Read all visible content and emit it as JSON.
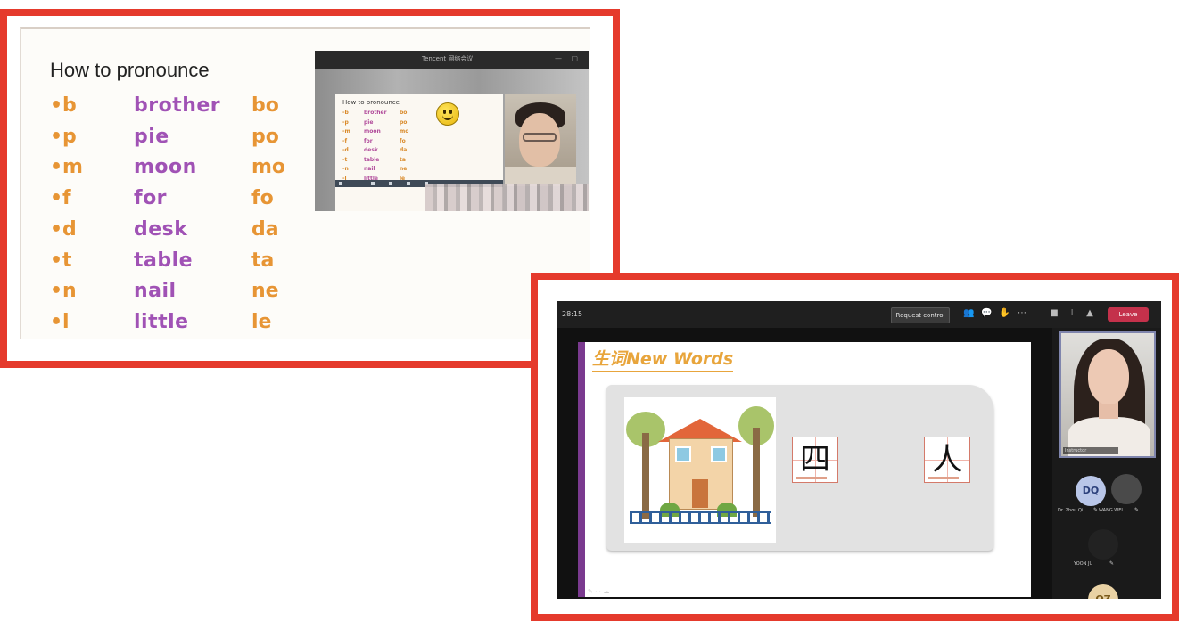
{
  "shot1": {
    "slide_title": "How to pronounce",
    "rows": [
      {
        "bullet": "•b",
        "word": "brother",
        "syllable": "bo"
      },
      {
        "bullet": "•p",
        "word": "pie",
        "syllable": "po"
      },
      {
        "bullet": "•m",
        "word": "moon",
        "syllable": "mo"
      },
      {
        "bullet": "•f",
        "word": "for",
        "syllable": "fo"
      },
      {
        "bullet": "•d",
        "word": "desk",
        "syllable": "da"
      },
      {
        "bullet": "•t",
        "word": "table",
        "syllable": "ta"
      },
      {
        "bullet": "•n",
        "word": "nail",
        "syllable": "ne"
      },
      {
        "bullet": "•l",
        "word": "little",
        "syllable": "le"
      }
    ],
    "embedded": {
      "window_title": "Tencent 网络会议",
      "minimize": "—",
      "maximize": "▢",
      "slide_title": "How to pronounce",
      "rows": [
        {
          "bullet": "-b",
          "word": "brother",
          "syllable": "bo"
        },
        {
          "bullet": "-p",
          "word": "pie",
          "syllable": "po"
        },
        {
          "bullet": "-m",
          "word": "moon",
          "syllable": "mo"
        },
        {
          "bullet": "-f",
          "word": "for",
          "syllable": "fo"
        },
        {
          "bullet": "-d",
          "word": "desk",
          "syllable": "da"
        },
        {
          "bullet": "-t",
          "word": "table",
          "syllable": "ta"
        },
        {
          "bullet": "-n",
          "word": "nail",
          "syllable": "ne"
        },
        {
          "bullet": "-l",
          "word": "little",
          "syllable": "le"
        }
      ]
    }
  },
  "shot2": {
    "time": "28:15",
    "request_control": "Request control",
    "controls": [
      "people-icon",
      "chat-icon",
      "raise-hand-icon",
      "more-icon",
      "camera-icon",
      "mic-icon",
      "share-icon"
    ],
    "control_glyphs": [
      "👥",
      "💬",
      "✋",
      "⋯",
      "■",
      "⊥",
      "▲"
    ],
    "leave": "Leave",
    "slide_title": "生词New Words",
    "characters": [
      "四",
      "人"
    ],
    "bottom_tools": "✎ ⋯ ☁",
    "participants": [
      {
        "initials": "DQ",
        "name": "Dr. Zhou Qi",
        "color": "#b9c6e8",
        "text_color": "#2b3f7a"
      },
      {
        "initials": "",
        "name": "WANG WEI",
        "color": "#4a4a4a",
        "text_color": "#ffffff"
      },
      {
        "initials": "",
        "name": "YOON JU",
        "color": "#222222",
        "text_color": "#ffffff"
      },
      {
        "initials": "QZ",
        "name": "",
        "color": "#e9d2a4",
        "text_color": "#7a5a1a"
      }
    ],
    "main_cam_name": "Instructor",
    "mic_glyph": "✎"
  }
}
